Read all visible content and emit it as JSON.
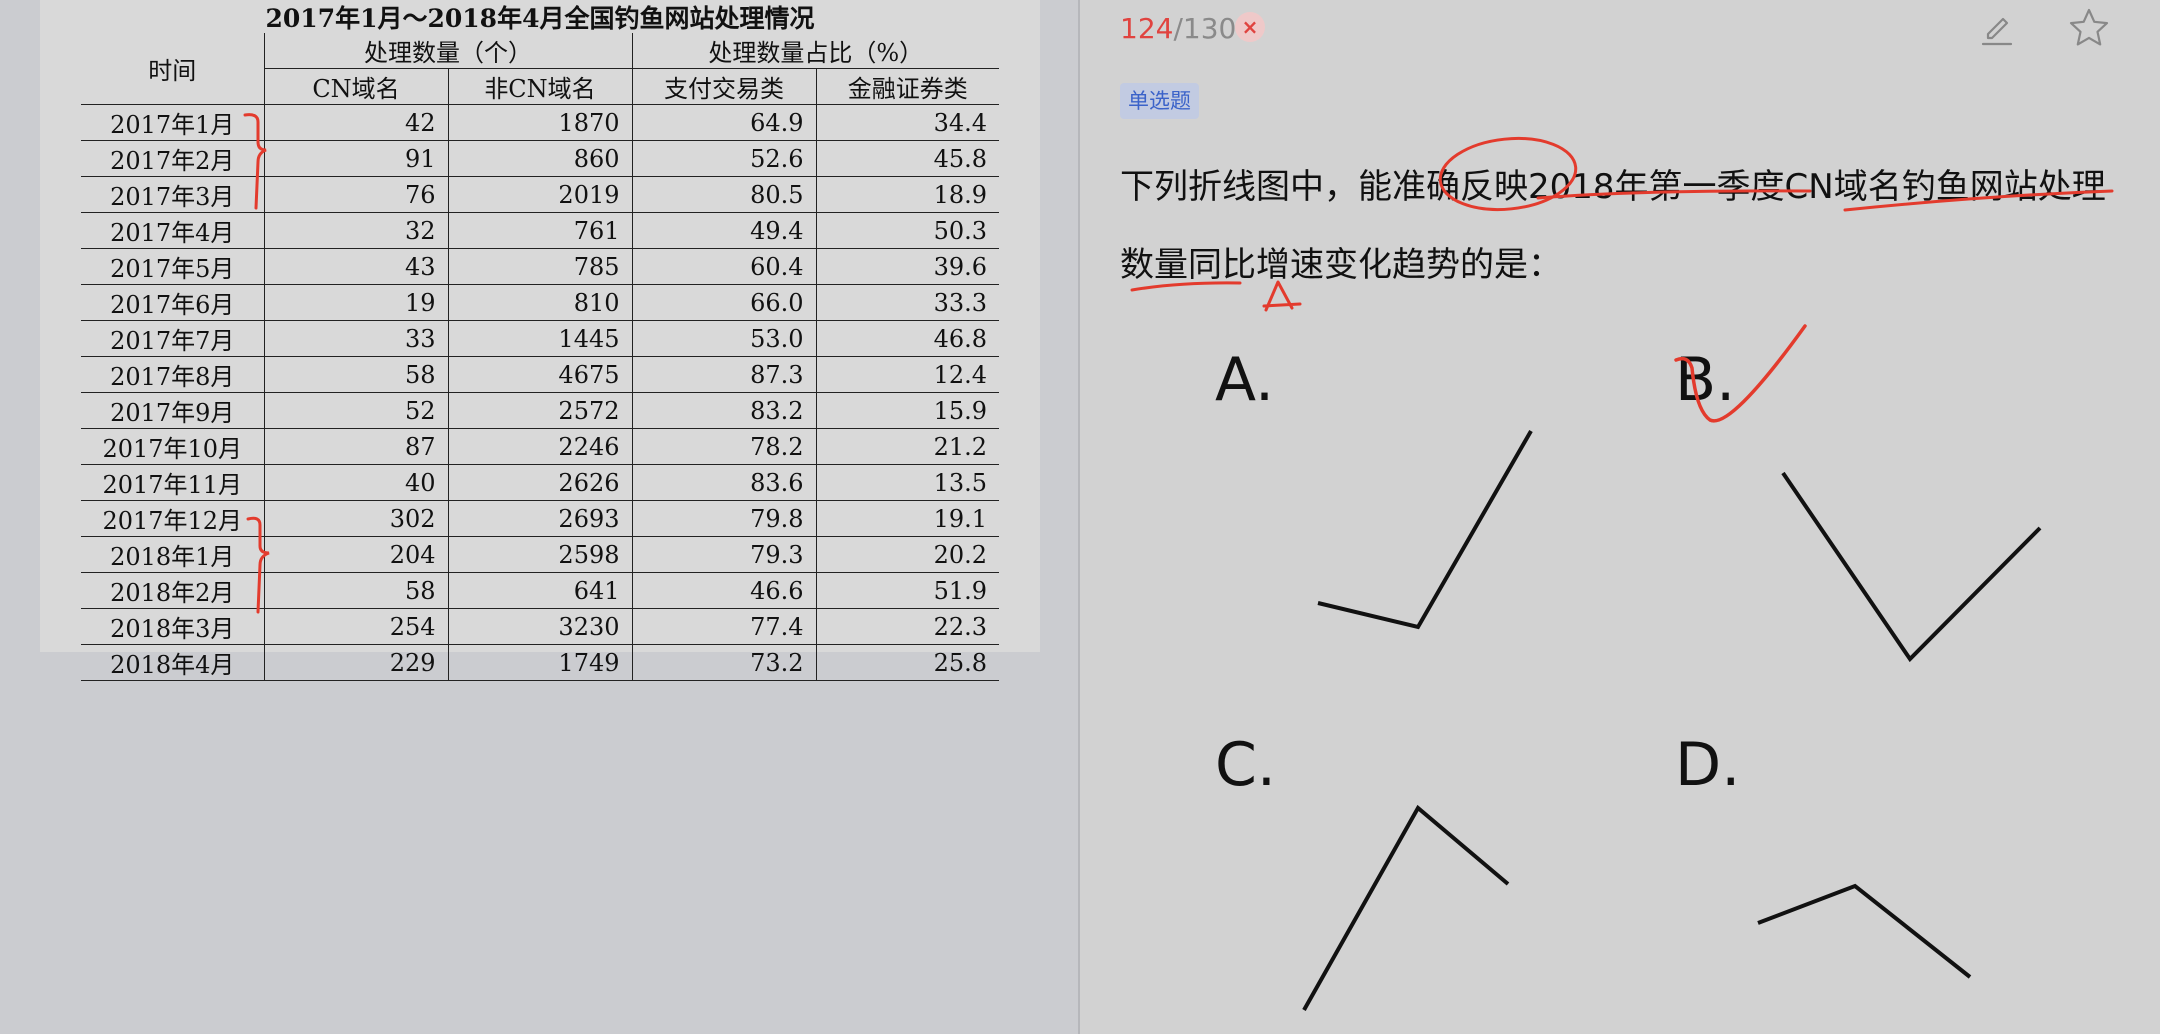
{
  "table": {
    "title": "2017年1月～2018年4月全国钓鱼网站处理情况",
    "header_time": "时间",
    "header_group_count": "处理数量（个）",
    "header_group_pct": "处理数量占比（%）",
    "sub_headers": [
      "CN域名",
      "非CN域名",
      "支付交易类",
      "金融证券类"
    ],
    "rows": [
      {
        "time": "2017年1月",
        "cn": "42",
        "noncn": "1870",
        "pay": "64.9",
        "fin": "34.4"
      },
      {
        "time": "2017年2月",
        "cn": "91",
        "noncn": "860",
        "pay": "52.6",
        "fin": "45.8"
      },
      {
        "time": "2017年3月",
        "cn": "76",
        "noncn": "2019",
        "pay": "80.5",
        "fin": "18.9"
      },
      {
        "time": "2017年4月",
        "cn": "32",
        "noncn": "761",
        "pay": "49.4",
        "fin": "50.3"
      },
      {
        "time": "2017年5月",
        "cn": "43",
        "noncn": "785",
        "pay": "60.4",
        "fin": "39.6"
      },
      {
        "time": "2017年6月",
        "cn": "19",
        "noncn": "810",
        "pay": "66.0",
        "fin": "33.3"
      },
      {
        "time": "2017年7月",
        "cn": "33",
        "noncn": "1445",
        "pay": "53.0",
        "fin": "46.8"
      },
      {
        "time": "2017年8月",
        "cn": "58",
        "noncn": "4675",
        "pay": "87.3",
        "fin": "12.4"
      },
      {
        "time": "2017年9月",
        "cn": "52",
        "noncn": "2572",
        "pay": "83.2",
        "fin": "15.9"
      },
      {
        "time": "2017年10月",
        "cn": "87",
        "noncn": "2246",
        "pay": "78.2",
        "fin": "21.2"
      },
      {
        "time": "2017年11月",
        "cn": "40",
        "noncn": "2626",
        "pay": "83.6",
        "fin": "13.5"
      },
      {
        "time": "2017年12月",
        "cn": "302",
        "noncn": "2693",
        "pay": "79.8",
        "fin": "19.1"
      },
      {
        "time": "2018年1月",
        "cn": "204",
        "noncn": "2598",
        "pay": "79.3",
        "fin": "20.2"
      },
      {
        "time": "2018年2月",
        "cn": "58",
        "noncn": "641",
        "pay": "46.6",
        "fin": "51.9"
      },
      {
        "time": "2018年3月",
        "cn": "254",
        "noncn": "3230",
        "pay": "77.4",
        "fin": "22.3"
      },
      {
        "time": "2018年4月",
        "cn": "229",
        "noncn": "1749",
        "pay": "73.2",
        "fin": "25.8"
      }
    ]
  },
  "header": {
    "current": "124",
    "total": "/130",
    "wrong_mark": "×"
  },
  "question": {
    "type_tag": "单选题",
    "text": "下列折线图中，能准确反映2018年第一季度CN域名钓鱼网站处理数量同比增速变化趋势的是：",
    "options": [
      "A.",
      "B.",
      "C.",
      "D."
    ]
  },
  "icons": {
    "edit": "edit-icon",
    "favorite": "star-icon",
    "wrong": "close-icon"
  },
  "colors": {
    "accent_red": "#e0433f",
    "tag_bg": "#c2cbe2",
    "tag_text": "#3b63c9",
    "ink_red": "#e33b2d"
  }
}
